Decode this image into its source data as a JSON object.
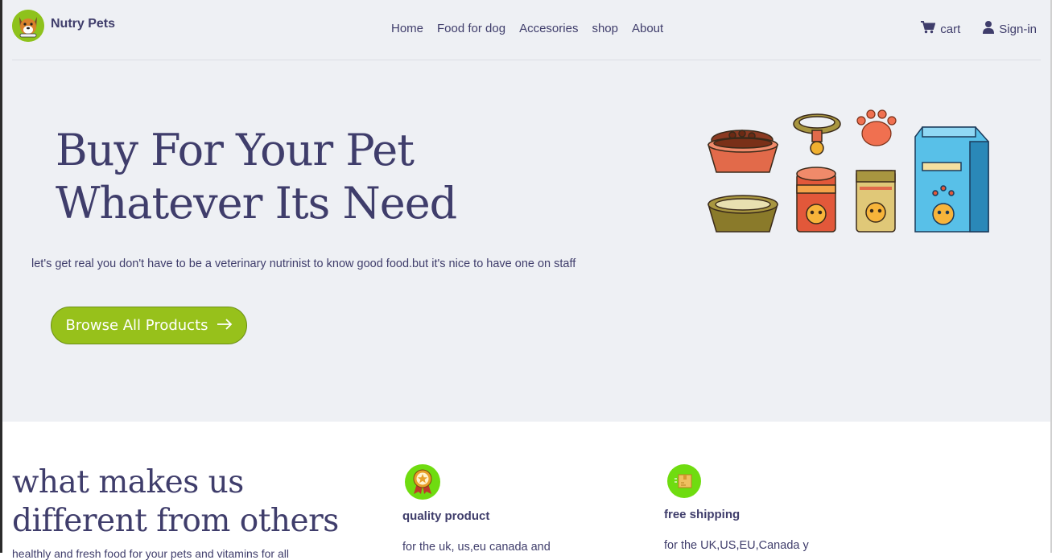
{
  "brand": {
    "name": "Nutry Pets",
    "logo_icon": "dog-logo-icon"
  },
  "nav": {
    "links": [
      "Home",
      "Food for dog",
      "Accesories",
      "shop",
      "About"
    ],
    "cart_label": "cart",
    "signin_label": "Sign-in"
  },
  "hero": {
    "title_line1": "Buy For Your Pet",
    "title_line2": "Whatever Its Need",
    "subtitle": "let's get real you don't have to be a veterinary nutrinist to know good food.but it's nice to have one on staff",
    "cta_label": "Browse All Products",
    "illustration": "pet-supplies-illustration"
  },
  "features": {
    "heading_line1": "what makes us",
    "heading_line2": "different from others",
    "heading_cut_text": "healthly and fresh food for your pets and vitamins for all",
    "items": [
      {
        "icon": "award-badge-icon",
        "title": "quality product",
        "text": "for the uk, us,eu canada and"
      },
      {
        "icon": "shipping-box-icon",
        "title": "free shipping",
        "text": "for the UK,US,EU,Canada y"
      }
    ]
  },
  "colors": {
    "accent_green": "#97c11b",
    "text_navy": "#3f3d6b",
    "hero_background": "#eef0f4",
    "feature_icon_green": "#6fdc10"
  }
}
